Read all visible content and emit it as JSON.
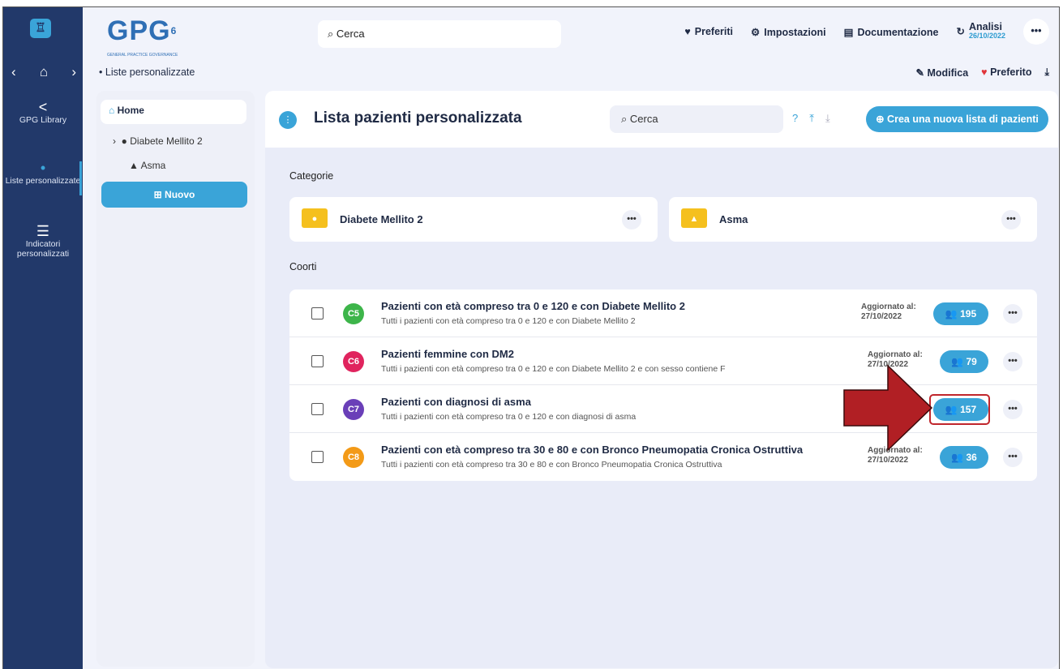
{
  "rail": {
    "library": "GPG Library",
    "custom_lists": "Liste personalizzate",
    "indicators": "Indicatori personalizzati"
  },
  "topbar": {
    "brand": "GPG",
    "brand_version": "6",
    "brand_tag": "GENERAL PRACTICE GOVERNANCE",
    "search_placeholder": "Cerca",
    "favorites": "Preferiti",
    "settings": "Impostazioni",
    "documentation": "Documentazione",
    "analysis": "Analisi",
    "analysis_date": "26/10/2022",
    "more": "•••"
  },
  "subbar": {
    "breadcrumb": "Liste personalizzate",
    "edit": "Modifica",
    "favorite": "Preferito"
  },
  "tree": {
    "home": "Home",
    "items": [
      "Diabete Mellito 2",
      "Asma"
    ],
    "new_button": "Nuovo"
  },
  "main": {
    "title": "Lista pazienti personalizzata",
    "search_placeholder": "Cerca",
    "create_button": "Crea una nuova lista di pazienti",
    "categories_label": "Categorie",
    "cohorts_label": "Coorti",
    "categories": [
      "Diabete Mellito 2",
      "Asma"
    ],
    "cohorts": [
      {
        "code": "C5",
        "color": "#3db54a",
        "title": "Pazienti con età compreso tra 0 e 120 e con Diabete Mellito 2",
        "desc": "Tutti i pazienti con età compreso tra 0 e 120 e con Diabete Mellito 2",
        "updated_label": "Aggiornato al:",
        "updated_date": "27/10/2022",
        "count": "195"
      },
      {
        "code": "C6",
        "color": "#e0245e",
        "title": "Pazienti femmine con DM2",
        "desc": "Tutti i pazienti con età compreso tra 0 e 120 e con Diabete Mellito 2 e con sesso contiene F",
        "updated_label": "Aggiornato al:",
        "updated_date": "27/10/2022",
        "count": "79"
      },
      {
        "code": "C7",
        "color": "#6a3fb8",
        "title": "Pazienti con diagnosi di asma",
        "desc": "Tutti i pazienti con età compreso tra 0 e 120 e con diagnosi di asma",
        "updated_label": "",
        "updated_date": "",
        "count": "157"
      },
      {
        "code": "C8",
        "color": "#f39a17",
        "title": "Pazienti con età compreso tra 30 e 80 e con Bronco Pneumopatia Cronica Ostruttiva",
        "desc": "Tutti i pazienti con età compreso tra 30 e 80 e con Bronco Pneumopatia Cronica Ostruttiva",
        "updated_label": "Aggiornato al:",
        "updated_date": "27/10/2022",
        "count": "36"
      }
    ]
  },
  "colors": {
    "accent": "#3aa4d8",
    "rail": "#22396a",
    "arrow": "#b11f24"
  }
}
